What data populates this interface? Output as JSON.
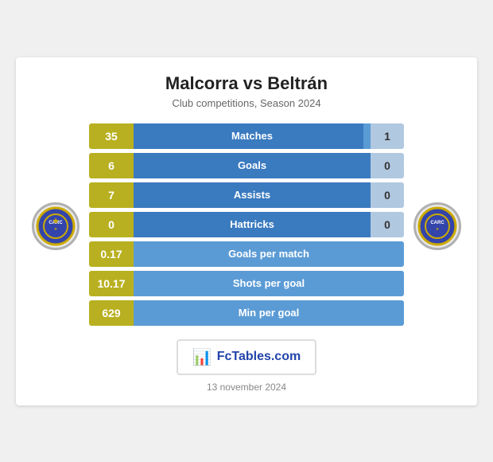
{
  "header": {
    "title": "Malcorra vs Beltrán",
    "subtitle": "Club competitions, Season 2024"
  },
  "stats": [
    {
      "label": "Matches",
      "left_val": "35",
      "right_val": "1",
      "fill_pct": 97
    },
    {
      "label": "Goals",
      "left_val": "6",
      "right_val": "0",
      "fill_pct": 100
    },
    {
      "label": "Assists",
      "left_val": "7",
      "right_val": "0",
      "fill_pct": 100
    },
    {
      "label": "Hattricks",
      "left_val": "0",
      "right_val": "0",
      "fill_pct": 100
    }
  ],
  "stats_full": [
    {
      "label": "Goals per match",
      "left_val": "0.17"
    },
    {
      "label": "Shots per goal",
      "left_val": "10.17"
    },
    {
      "label": "Min per goal",
      "left_val": "629"
    }
  ],
  "logo": {
    "icon": "📊",
    "text": "FcTables.com"
  },
  "footer": {
    "date": "13 november 2024"
  }
}
